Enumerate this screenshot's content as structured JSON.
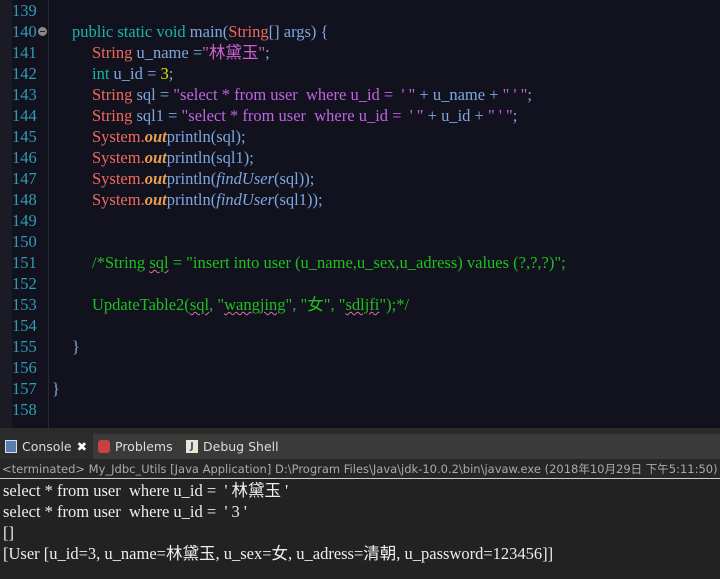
{
  "editor": {
    "lines": [
      {
        "n": "139",
        "tokens": []
      },
      {
        "n": "140",
        "fold": true,
        "indent": 0,
        "tokens": [
          {
            "t": "public static void ",
            "c": "#17b5a8"
          },
          {
            "t": "main(",
            "c": "#7da7e0"
          },
          {
            "t": "String",
            "c": "#f06a5e"
          },
          {
            "t": "[] args) {",
            "c": "#7da7e0"
          }
        ]
      },
      {
        "n": "141",
        "indent": 1,
        "tokens": [
          {
            "t": "String ",
            "c": "#f06a5e"
          },
          {
            "t": "u_name =",
            "c": "#7da7e0"
          },
          {
            "t": "\"林黛玉\"",
            "c": "#d060d0"
          },
          {
            "t": ";",
            "c": "#7da7e0"
          }
        ]
      },
      {
        "n": "142",
        "indent": 1,
        "tokens": [
          {
            "t": "int ",
            "c": "#17b5a8"
          },
          {
            "t": "u_id = ",
            "c": "#7da7e0"
          },
          {
            "t": "3",
            "c": "#e8e000"
          },
          {
            "t": ";",
            "c": "#7da7e0"
          }
        ]
      },
      {
        "n": "143",
        "indent": 1,
        "tokens": [
          {
            "t": "String ",
            "c": "#f06a5e"
          },
          {
            "t": "sql = ",
            "c": "#7da7e0"
          },
          {
            "t": "\"select * from user  where u_id =  ' \"",
            "c": "#c064e0"
          },
          {
            "t": " + u_name + ",
            "c": "#7da7e0"
          },
          {
            "t": "\" ' \"",
            "c": "#c064e0"
          },
          {
            "t": ";",
            "c": "#7da7e0"
          }
        ]
      },
      {
        "n": "144",
        "indent": 1,
        "tokens": [
          {
            "t": "String ",
            "c": "#f06a5e"
          },
          {
            "t": "sql1 = ",
            "c": "#7da7e0"
          },
          {
            "t": "\"select * from user  where u_id =  ' \"",
            "c": "#c064e0"
          },
          {
            "t": " + u_id + ",
            "c": "#7da7e0"
          },
          {
            "t": "\" ' \"",
            "c": "#c064e0"
          },
          {
            "t": ";",
            "c": "#7da7e0"
          }
        ]
      },
      {
        "n": "145",
        "indent": 1,
        "tokens": [
          {
            "t": "System.",
            "c": "#f06a5e"
          },
          {
            "t": "out",
            "c": "#e8a050",
            "s": "bi"
          },
          {
            "t": "println(sql);",
            "c": "#7da7e0"
          }
        ]
      },
      {
        "n": "146",
        "indent": 1,
        "tokens": [
          {
            "t": "System.",
            "c": "#f06a5e"
          },
          {
            "t": "out",
            "c": "#e8a050",
            "s": "bi"
          },
          {
            "t": "println(sql1);",
            "c": "#7da7e0"
          }
        ]
      },
      {
        "n": "147",
        "indent": 1,
        "tokens": [
          {
            "t": "System.",
            "c": "#f06a5e"
          },
          {
            "t": "out",
            "c": "#e8a050",
            "s": "bi"
          },
          {
            "t": "println(",
            "c": "#7da7e0"
          },
          {
            "t": "findUser",
            "c": "#7da7e0",
            "s": "i"
          },
          {
            "t": "(sql));",
            "c": "#7da7e0"
          }
        ]
      },
      {
        "n": "148",
        "indent": 1,
        "tokens": [
          {
            "t": "System.",
            "c": "#f06a5e"
          },
          {
            "t": "out",
            "c": "#e8a050",
            "s": "bi"
          },
          {
            "t": "println(",
            "c": "#7da7e0"
          },
          {
            "t": "findUser",
            "c": "#7da7e0",
            "s": "i"
          },
          {
            "t": "(sql1));",
            "c": "#7da7e0"
          }
        ]
      },
      {
        "n": "149",
        "tokens": []
      },
      {
        "n": "150",
        "tokens": []
      },
      {
        "n": "151",
        "indent": 1,
        "tokens": [
          {
            "t": "/*String ",
            "c": "#1ec01e"
          },
          {
            "t": "sql",
            "c": "#1ec01e",
            "s": "sq"
          },
          {
            "t": " = \"insert into user (u_name,u_sex,u_adress) values (?,?,?)\";",
            "c": "#1ec01e"
          }
        ]
      },
      {
        "n": "152",
        "tokens": []
      },
      {
        "n": "153",
        "indent": 1,
        "tokens": [
          {
            "t": "UpdateTable2(",
            "c": "#1ec01e"
          },
          {
            "t": "sql",
            "c": "#1ec01e",
            "s": "sq"
          },
          {
            "t": ", \"",
            "c": "#1ec01e"
          },
          {
            "t": "wangjing",
            "c": "#1ec01e",
            "s": "sq"
          },
          {
            "t": "\", \"女\", \"",
            "c": "#1ec01e"
          },
          {
            "t": "sdljfi",
            "c": "#1ec01e",
            "s": "sq"
          },
          {
            "t": "\");*/",
            "c": "#1ec01e"
          }
        ]
      },
      {
        "n": "154",
        "tokens": []
      },
      {
        "n": "155",
        "indent": 0,
        "tokens": [
          {
            "t": "}",
            "c": "#7da7e0"
          }
        ]
      },
      {
        "n": "156",
        "tokens": []
      },
      {
        "n": "157",
        "indent": -1,
        "tokens": [
          {
            "t": "}",
            "c": "#7da7e0"
          }
        ]
      },
      {
        "n": "158",
        "tokens": []
      }
    ]
  },
  "tabs": {
    "console": "Console",
    "problems": "Problems",
    "debug_shell": "Debug Shell"
  },
  "status": "<terminated> My_Jdbc_Utils [Java Application] D:\\Program Files\\Java\\jdk-10.0.2\\bin\\javaw.exe (2018年10月29日 下午5:11:50)",
  "console": [
    "select * from user  where u_id =  ' 林黛玉 '",
    "select * from user  where u_id =  ' 3 '",
    "[]",
    "[User [u_id=3, u_name=林黛玉, u_sex=女, u_adress=清朝, u_password=123456]]"
  ]
}
